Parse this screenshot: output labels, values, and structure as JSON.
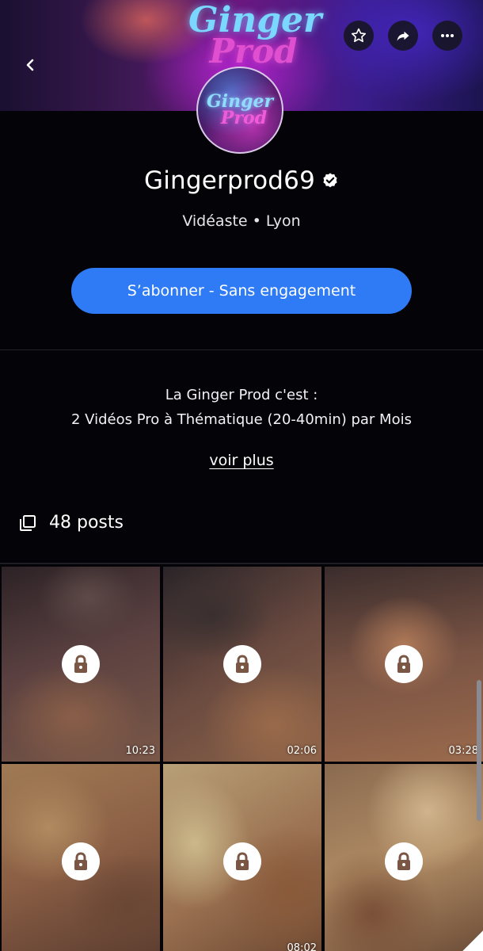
{
  "header": {
    "banner_logo_line1": "Ginger",
    "banner_logo_line2": "Prod"
  },
  "avatar": {
    "logo_line1": "Ginger",
    "logo_line2": "Prod"
  },
  "profile": {
    "name": "Gingerprod69",
    "verified": true,
    "subtitle": "Vidéaste • Lyon"
  },
  "subscribe": {
    "label": "S’abonner - Sans engagement"
  },
  "bio": {
    "line1": "La Ginger Prod c'est :",
    "line2": "2 Vidéos Pro à Thématique (20-40min) par Mois",
    "more_label": "voir plus"
  },
  "posts": {
    "count_label": "48 posts"
  },
  "grid": {
    "tiles": [
      {
        "duration": "10:23",
        "locked": true
      },
      {
        "duration": "02:06",
        "locked": true
      },
      {
        "duration": "03:28",
        "locked": true
      },
      {
        "duration": "",
        "locked": true
      },
      {
        "duration": "08:02",
        "locked": true
      },
      {
        "duration": "",
        "locked": true
      }
    ]
  },
  "colors": {
    "accent": "#2f7bf5",
    "background": "#040408",
    "lock_icon": "#7a5644"
  },
  "icons": {
    "back": "chevron-left-icon",
    "favorite": "star-icon",
    "share": "share-icon",
    "more": "more-icon",
    "verified": "verified-badge-icon",
    "posts": "posts-stack-icon",
    "lock": "lock-icon"
  }
}
